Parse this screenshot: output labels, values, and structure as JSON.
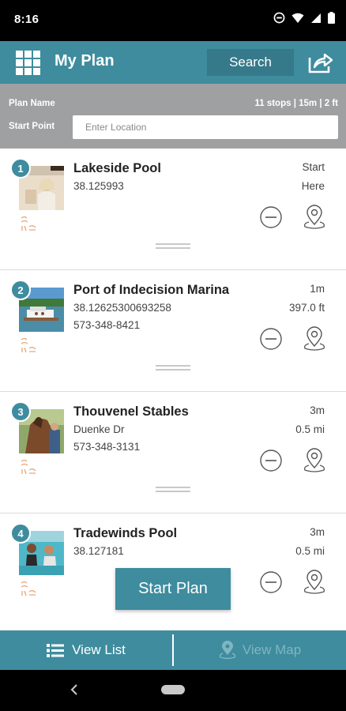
{
  "status_bar": {
    "time": "8:16",
    "icons": [
      "do-not-disturb-icon",
      "wifi-icon",
      "signal-icon",
      "battery-icon"
    ]
  },
  "header": {
    "title": "My Plan",
    "search_label": "Search",
    "menu_icon": "grid-menu-icon",
    "share_icon": "share-icon"
  },
  "plan": {
    "plan_name_label": "Plan Name",
    "summary": "11 stops | 15m | 2 ft",
    "start_point_label": "Start Point",
    "location_placeholder": "Enter Location"
  },
  "stops": [
    {
      "number": "1",
      "title": "Lakeside Pool",
      "line1": "38.125993",
      "line2": "",
      "meta1": "Start",
      "meta2": "Here"
    },
    {
      "number": "2",
      "title": "Port of Indecision Marina",
      "line1": "38.12625300693258",
      "line2": "573-348-8421",
      "meta1": "1m",
      "meta2": "397.0 ft"
    },
    {
      "number": "3",
      "title": "Thouvenel Stables",
      "line1": "Duenke Dr",
      "line2": "573-348-3131",
      "meta1": "3m",
      "meta2": "0.5 mi"
    },
    {
      "number": "4",
      "title": "Tradewinds Pool",
      "line1": "38.127181",
      "line2": "",
      "meta1": "3m",
      "meta2": "0.5 mi"
    }
  ],
  "start_plan_label": "Start Plan",
  "tabs": {
    "view_list": "View List",
    "view_map": "View Map"
  },
  "colors": {
    "primary": "#3e8c9e",
    "primary_dark": "#36798a",
    "plan_bar": "#9fa0a2",
    "brand_orange": "#e8a77a"
  }
}
